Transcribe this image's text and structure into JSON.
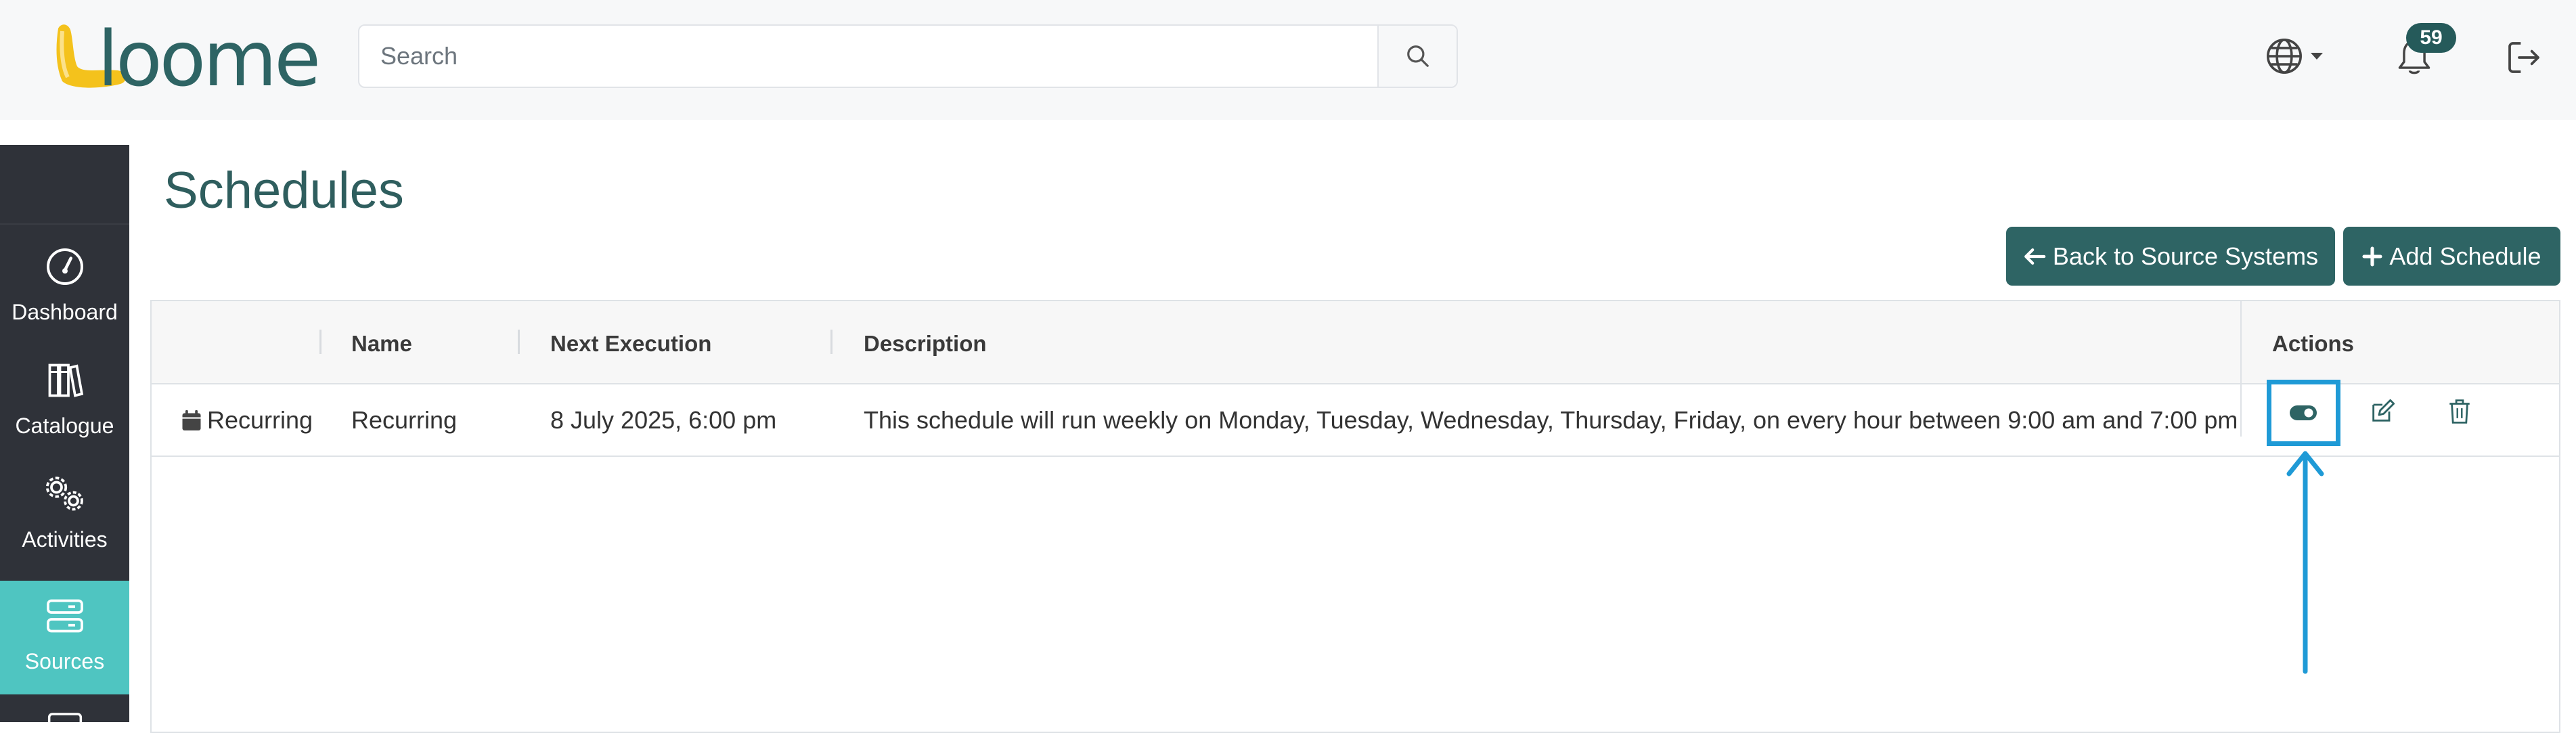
{
  "header": {
    "logo_text": "loome",
    "search": {
      "placeholder": "Search",
      "value": ""
    },
    "notifications": {
      "count": "59"
    },
    "icons": {
      "search": "search-icon",
      "language": "globe-icon",
      "notifications": "bell-icon",
      "logout": "logout-icon"
    }
  },
  "sidebar": {
    "items": [
      {
        "label": "Dashboard",
        "icon": "gauge-icon",
        "active": false
      },
      {
        "label": "Catalogue",
        "icon": "books-icon",
        "active": false
      },
      {
        "label": "Activities",
        "icon": "gears-icon",
        "active": false
      },
      {
        "label": "Sources",
        "icon": "server-icon",
        "active": true
      }
    ]
  },
  "page": {
    "title": "Schedules",
    "back_button": "Back to Source Systems",
    "add_button": "Add Schedule"
  },
  "table": {
    "columns": [
      "",
      "Name",
      "Next Execution",
      "Description",
      "Actions"
    ],
    "rows": [
      {
        "type": "Recurring",
        "name": "Recurring",
        "next_execution": "8 July 2025, 6:00 pm",
        "description": "This schedule will run weekly on Monday, Tuesday, Wednesday, Thursday, Friday, on every hour between 9:00 am and 7:00 pm",
        "actions": [
          "toggle-icon",
          "edit-icon",
          "trash-icon"
        ]
      }
    ]
  },
  "colors": {
    "brand": "#2e6464",
    "sidebar": "#2f3239",
    "active_nav": "#4fc5c1",
    "highlight": "#1f9ad6"
  }
}
